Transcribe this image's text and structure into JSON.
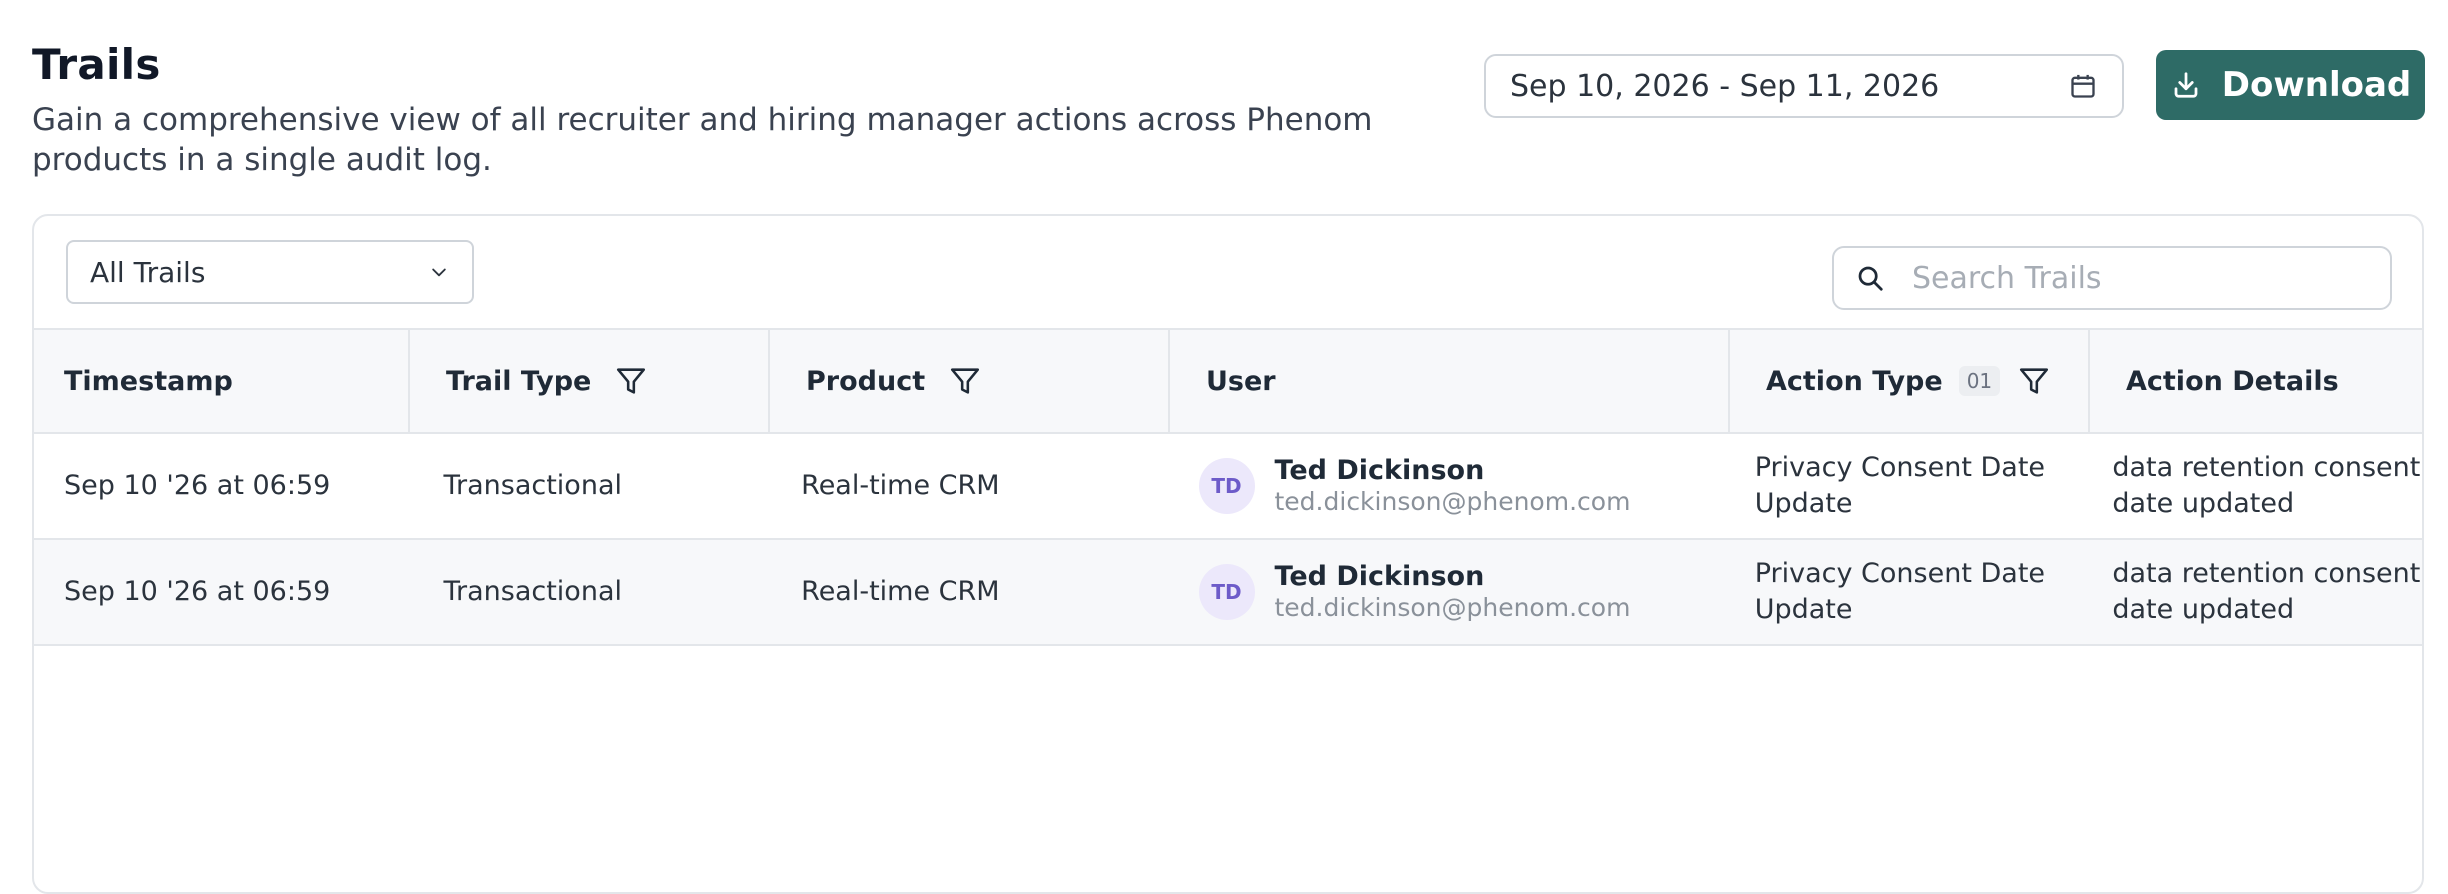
{
  "header": {
    "title": "Trails",
    "subtitle": "Gain a comprehensive view of all recruiter and hiring manager actions across Phenom products in a single audit log."
  },
  "date_range": {
    "value": "Sep 10, 2026 - Sep 11, 2026",
    "icon": "calendar-icon"
  },
  "download": {
    "label": "Download",
    "icon": "download-icon"
  },
  "filters": {
    "trail_select": "All Trails",
    "search_placeholder": "Search Trails"
  },
  "table": {
    "columns": {
      "timestamp": "Timestamp",
      "trail_type": "Trail Type",
      "product": "Product",
      "user": "User",
      "action_type": "Action Type",
      "action_type_count": "01",
      "action_details": "Action Details"
    },
    "rows": [
      {
        "timestamp": "Sep 10 '26 at 06:59",
        "trail_type": "Transactional",
        "product": "Real-time CRM",
        "user_initials": "TD",
        "user_name": "Ted Dickinson",
        "user_email": "ted.dickinson@phenom.com",
        "action_type": "Privacy Consent Date Update",
        "action_details": "data retention consent date updated"
      },
      {
        "timestamp": "Sep 10 '26 at 06:59",
        "trail_type": "Transactional",
        "product": "Real-time CRM",
        "user_initials": "TD",
        "user_name": "Ted Dickinson",
        "user_email": "ted.dickinson@phenom.com",
        "action_type": "Privacy Consent Date Update",
        "action_details": "data retention consent date updated"
      }
    ]
  },
  "colors": {
    "accent": "#2e6b66",
    "avatar_bg": "#ece8fb",
    "avatar_text": "#6d5bc9"
  }
}
